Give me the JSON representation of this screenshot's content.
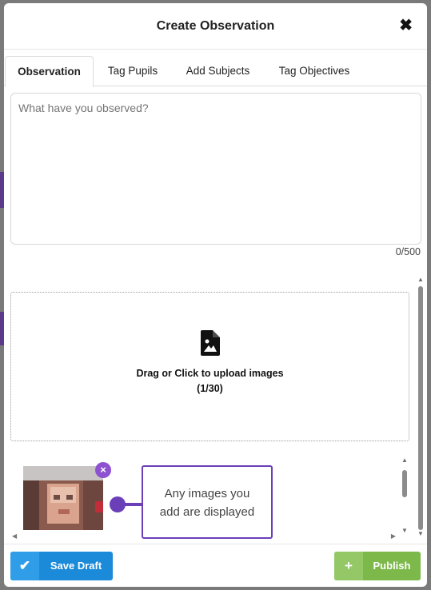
{
  "modal": {
    "title": "Create Observation",
    "close_label": "✖"
  },
  "tabs": [
    {
      "label": "Observation",
      "active": true
    },
    {
      "label": "Tag Pupils",
      "active": false
    },
    {
      "label": "Add Subjects",
      "active": false
    },
    {
      "label": "Tag Objectives",
      "active": false
    }
  ],
  "observation": {
    "placeholder": "What have you observed?",
    "value": "",
    "char_count": "0/500"
  },
  "upload": {
    "icon": "image-file-icon",
    "line1": "Drag or Click to upload images",
    "line2": "(1/30)"
  },
  "gallery": {
    "remove_label": "×",
    "callout_line1": "Any images you",
    "callout_line2": "add are displayed"
  },
  "footer": {
    "save_icon": "✔",
    "save_label": "Save Draft",
    "publish_icon": "+",
    "publish_label": "Publish"
  },
  "colors": {
    "accent_purple": "#6a3fb8",
    "save_blue": "#1a8ad9",
    "publish_green": "#7cb84a"
  }
}
